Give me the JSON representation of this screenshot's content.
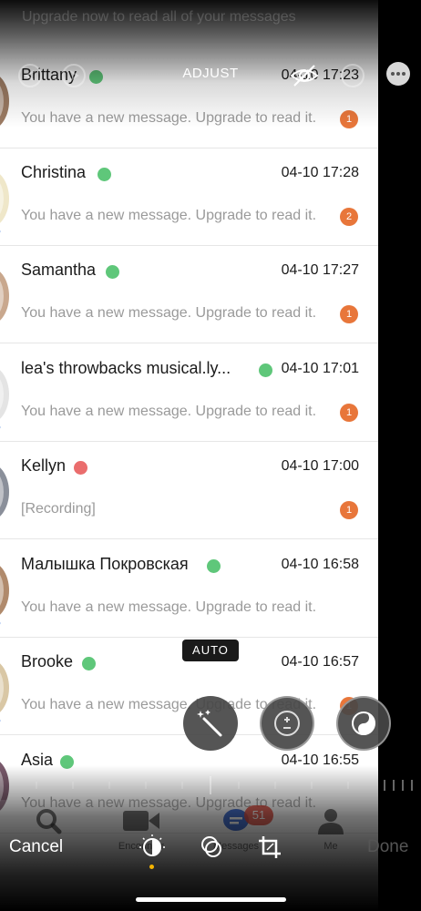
{
  "top_ghost_text": "Upgrade now to read all of your messages",
  "editor": {
    "title": "ADJUST",
    "auto_label": "AUTO",
    "cancel_label": "Cancel",
    "done_label": "Done"
  },
  "chats": [
    {
      "name": "Brittany",
      "status": "online",
      "time": "04-10 17:23",
      "message": "You have a new message. Upgrade to read it.",
      "unread": "1"
    },
    {
      "name": "Christina",
      "status": "online",
      "time": "04-10 17:28",
      "message": "You have a new message. Upgrade to read it.",
      "unread": "2"
    },
    {
      "name": "Samantha",
      "status": "online",
      "time": "04-10 17:27",
      "message": "You have a new message. Upgrade to read it.",
      "unread": "1"
    },
    {
      "name": "lea's throwbacks musical.ly...",
      "status": "online",
      "time": "04-10 17:01",
      "message": "You have a new message. Upgrade to read it.",
      "unread": "1"
    },
    {
      "name": "Kellyn",
      "status": "busy",
      "time": "04-10 17:00",
      "message": "[Recording]",
      "unread": "1"
    },
    {
      "name": "Малышка Покровская",
      "status": "online",
      "time": "04-10 16:58",
      "message": "You have a new message. Upgrade to read it.",
      "unread": ""
    },
    {
      "name": "Brooke",
      "status": "online",
      "time": "04-10 16:57",
      "message": "You have a new message. Upgrade to read it.",
      "unread": "1"
    },
    {
      "name": "Asia",
      "status": "online",
      "time": "04-10 16:55",
      "message": "You have a new message. Upgrade to read it.",
      "unread": ""
    }
  ],
  "ghost_tabs": {
    "encounter": "Encounter",
    "messages": "Messages",
    "me": "Me",
    "messages_badge": "51"
  },
  "colors": {
    "online": "#5fc77a",
    "busy": "#ea6d6d",
    "badge": "#e8763a",
    "accent": "#f5b400"
  },
  "icons": {
    "top": [
      "undo-icon",
      "redo-icon",
      "hide-original-icon",
      "compare-icon",
      "more-icon"
    ],
    "tools": [
      "magic-wand-icon",
      "exposure-icon",
      "contrast-icon"
    ],
    "modes": [
      "adjust-dial-icon",
      "filters-icon",
      "crop-rotate-icon"
    ]
  }
}
